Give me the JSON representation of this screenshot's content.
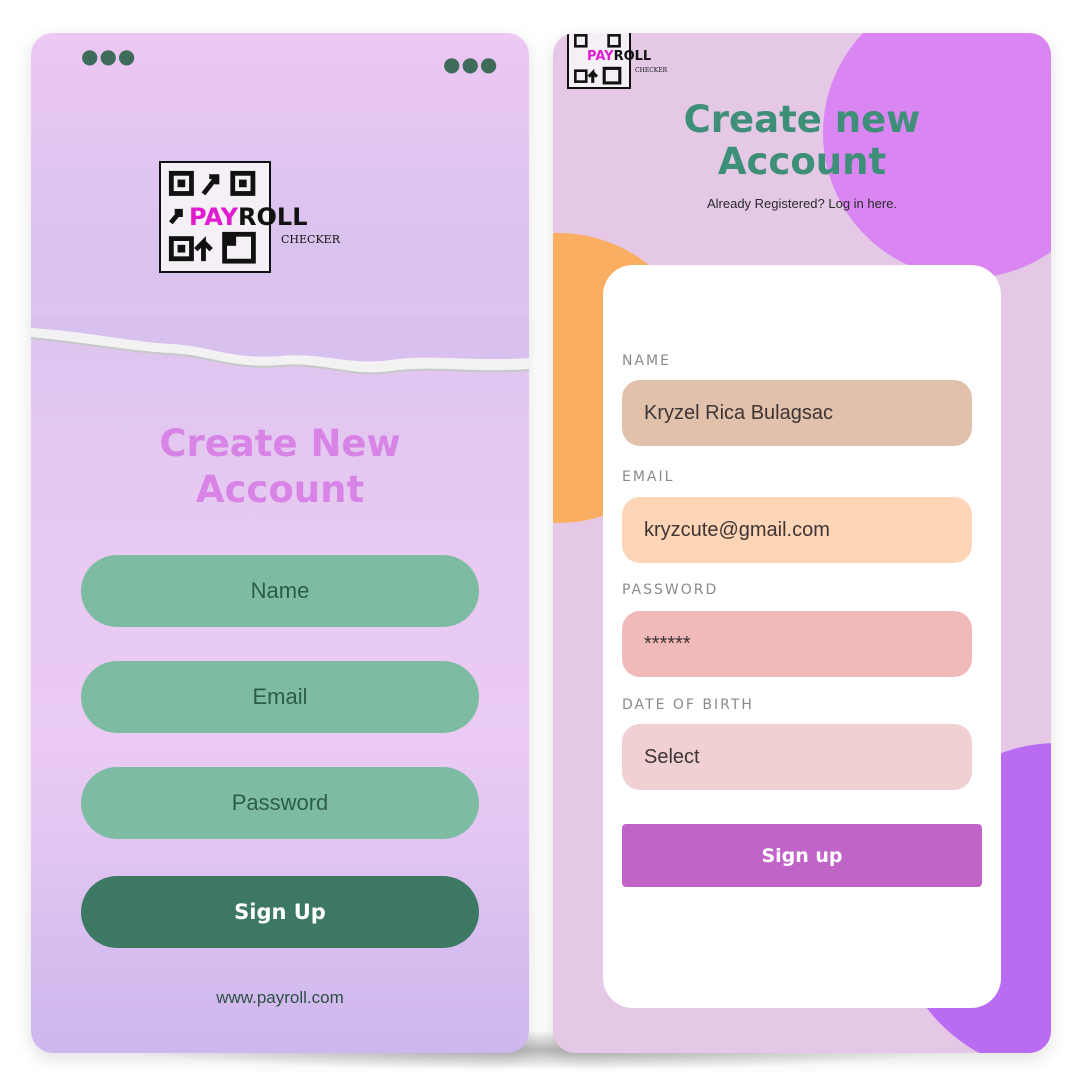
{
  "left_screen": {
    "menu_icon": "more-dots-icon",
    "logo": {
      "main": "PAYROLL",
      "highlight": "PAY",
      "rest": "ROLL",
      "sub": "CHECKER"
    },
    "title_line1": "Create New",
    "title_line2": "Account",
    "fields": {
      "name": "Name",
      "email": "Email",
      "password": "Password"
    },
    "signup_label": "Sign Up",
    "website": "www.payroll.com",
    "colors": {
      "title": "#d883e6",
      "pill": "#7dbca3",
      "signup": "#3c7862"
    }
  },
  "right_screen": {
    "logo": {
      "highlight": "PAY",
      "rest": "ROLL",
      "sub": "CHECKER"
    },
    "title_line1": "Create new",
    "title_line2": "Account",
    "subtitle": "Already Registered? Log in here.",
    "form": {
      "name_label": "NAME",
      "name_value": "Kryzel Rica Bulagsac",
      "email_label": "EMAIL",
      "email_value": "kryzcute@gmail.com",
      "password_label": "PASSWORD",
      "password_value": "******",
      "dob_label": "DATE OF BIRTH",
      "dob_value": "Select"
    },
    "signup_label": "Sign up",
    "colors": {
      "title": "#3d8f78",
      "signup": "#c064c8",
      "circle_top": "#d985f2",
      "circle_orange": "#f9ae62",
      "circle_bottom": "#b96cf2"
    }
  }
}
